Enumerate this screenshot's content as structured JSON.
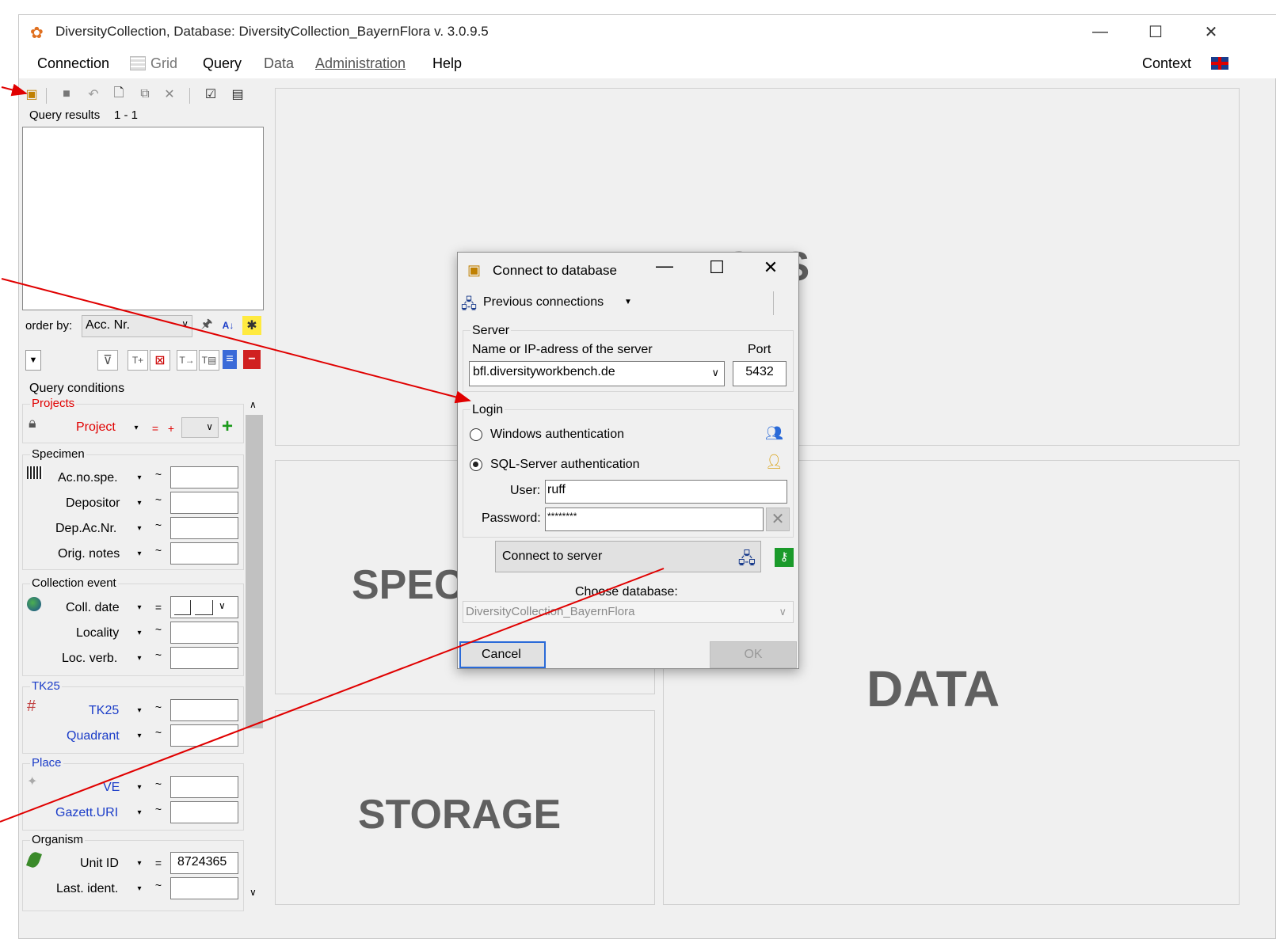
{
  "window": {
    "title": "DiversityCollection,  Database: DiversityCollection_BayernFlora   v. 3.0.9.5",
    "minimize": "—",
    "maximize": "☐",
    "close": "✕"
  },
  "menu": {
    "connection": "Connection",
    "grid": "Grid",
    "query": "Query",
    "data": "Data",
    "administration": "Administration",
    "help": "Help",
    "context": "Context"
  },
  "query_panel": {
    "results_label": "Query results",
    "results_range": "1 - 1",
    "order_by_label": "order by:",
    "order_by_value": "Acc. Nr.",
    "conditions_label": "Query conditions"
  },
  "groups": {
    "projects": {
      "title": "Projects",
      "project_label": "Project",
      "op": "=",
      "plus": "+"
    },
    "specimen": {
      "title": "Specimen",
      "fields": [
        {
          "label": "Ac.no.spe.",
          "op": "~",
          "value": ""
        },
        {
          "label": "Depositor",
          "op": "~",
          "value": ""
        },
        {
          "label": "Dep.Ac.Nr.",
          "op": "~",
          "value": ""
        },
        {
          "label": "Orig. notes",
          "op": "~",
          "value": ""
        }
      ]
    },
    "collection_event": {
      "title": "Collection event",
      "fields": [
        {
          "label": "Coll. date",
          "op": "=",
          "value": ""
        },
        {
          "label": "Locality",
          "op": "~",
          "value": ""
        },
        {
          "label": "Loc. verb.",
          "op": "~",
          "value": ""
        }
      ]
    },
    "tk25": {
      "title": "TK25",
      "fields": [
        {
          "label": "TK25",
          "op": "~",
          "value": ""
        },
        {
          "label": "Quadrant",
          "op": "~",
          "value": ""
        }
      ]
    },
    "place": {
      "title": "Place",
      "fields": [
        {
          "label": "VE",
          "op": "~",
          "value": ""
        },
        {
          "label": "Gazett.URI",
          "op": "~",
          "value": ""
        }
      ]
    },
    "organism": {
      "title": "Organism",
      "fields": [
        {
          "label": "Unit ID",
          "op": "=",
          "value": "8724365"
        },
        {
          "label": "Last. ident.",
          "op": "~",
          "value": ""
        }
      ]
    }
  },
  "background_panels": {
    "images": "IMAGES",
    "specimen": "SPECIMEN",
    "storage": "STORAGE",
    "data": "DATA"
  },
  "dialog": {
    "title": "Connect to database",
    "previous_connections": "Previous connections",
    "server_group": "Server",
    "server_name_label": "Name or IP-adress of the server",
    "port_label": "Port",
    "server_value": "bfl.diversityworkbench.de",
    "port_value": "5432",
    "login_group": "Login",
    "windows_auth": "Windows authentication",
    "sql_auth": "SQL-Server authentication",
    "user_label": "User:",
    "user_value": "ruff",
    "password_label": "Password:",
    "password_value": "********",
    "connect_button": "Connect to server",
    "choose_db_label": "Choose database:",
    "database_value": "DiversityCollection_BayernFlora",
    "cancel": "Cancel",
    "ok": "OK"
  },
  "colors": {
    "annotation_arrow": "#e00000",
    "red_label": "#e00000",
    "blue_label": "#1a3cc8"
  }
}
